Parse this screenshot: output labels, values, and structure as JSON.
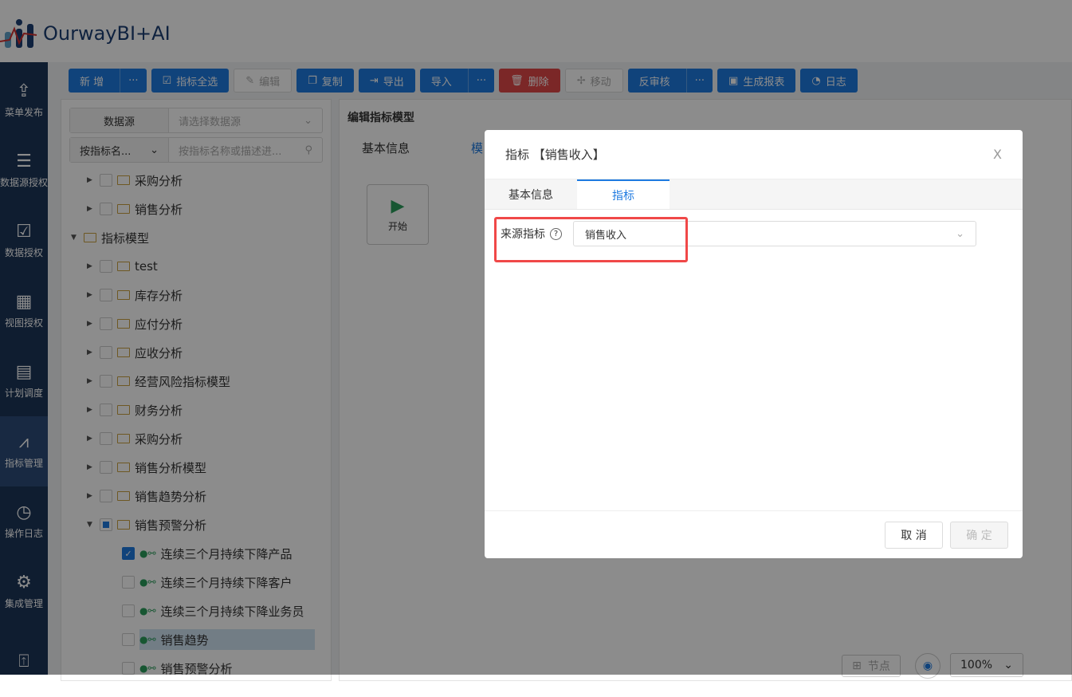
{
  "app": {
    "title": "OurwayBI+AI"
  },
  "sidebar": {
    "items": [
      {
        "label": "菜单发布",
        "icon": "upload-icon"
      },
      {
        "label": "数据源授权",
        "icon": "database-icon"
      },
      {
        "label": "数据授权",
        "icon": "data-auth-icon"
      },
      {
        "label": "视图授权",
        "icon": "view-auth-icon"
      },
      {
        "label": "计划调度",
        "icon": "calendar-icon"
      },
      {
        "label": "指标管理",
        "icon": "chart-icon"
      },
      {
        "label": "操作日志",
        "icon": "history-icon"
      },
      {
        "label": "集成管理",
        "icon": "settings-icon"
      },
      {
        "label": "",
        "icon": "upload-box-icon"
      }
    ]
  },
  "toolbar": {
    "add": "新 增",
    "more": "···",
    "select_all": "指标全选",
    "edit": "编辑",
    "copy": "复制",
    "export": "导出",
    "import": "导入",
    "delete": "删除",
    "move": "移动",
    "unaudit": "反审核",
    "report": "生成报表",
    "log": "日志"
  },
  "tree": {
    "datasource_label": "数据源",
    "datasource_placeholder": "请选择数据源",
    "search_mode": "按指标名...",
    "search_placeholder": "按指标名称或描述进...",
    "nodes": [
      {
        "label": "采购分析",
        "level": 1
      },
      {
        "label": "销售分析",
        "level": 1
      },
      {
        "label": "指标模型",
        "level": 0
      },
      {
        "label": "test",
        "level": 1
      },
      {
        "label": "库存分析",
        "level": 1
      },
      {
        "label": "应付分析",
        "level": 1
      },
      {
        "label": "应收分析",
        "level": 1
      },
      {
        "label": "经营风险指标模型",
        "level": 1
      },
      {
        "label": "财务分析",
        "level": 1
      },
      {
        "label": "采购分析",
        "level": 1
      },
      {
        "label": "销售分析模型",
        "level": 1
      },
      {
        "label": "销售趋势分析",
        "level": 1
      },
      {
        "label": "销售预警分析",
        "level": 1
      }
    ],
    "leaves": [
      {
        "label": "连续三个月持续下降产品",
        "checked": true
      },
      {
        "label": "连续三个月持续下降客户",
        "checked": false
      },
      {
        "label": "连续三个月持续下降业务员",
        "checked": false
      },
      {
        "label": "销售趋势",
        "checked": false
      },
      {
        "label": "销售预警分析",
        "checked": false
      }
    ]
  },
  "editor": {
    "title": "编辑指标模型",
    "tab_basic": "基本信息",
    "tab_model": "模",
    "start_label": "开始",
    "node_btn": "节点",
    "zoom": "100%"
  },
  "modal": {
    "title": "指标 【销售收入】",
    "close": "X",
    "tabs": [
      "基本信息",
      "指标"
    ],
    "field_label": "来源指标",
    "field_value": "销售收入",
    "cancel": "取 消",
    "confirm": "确 定"
  }
}
